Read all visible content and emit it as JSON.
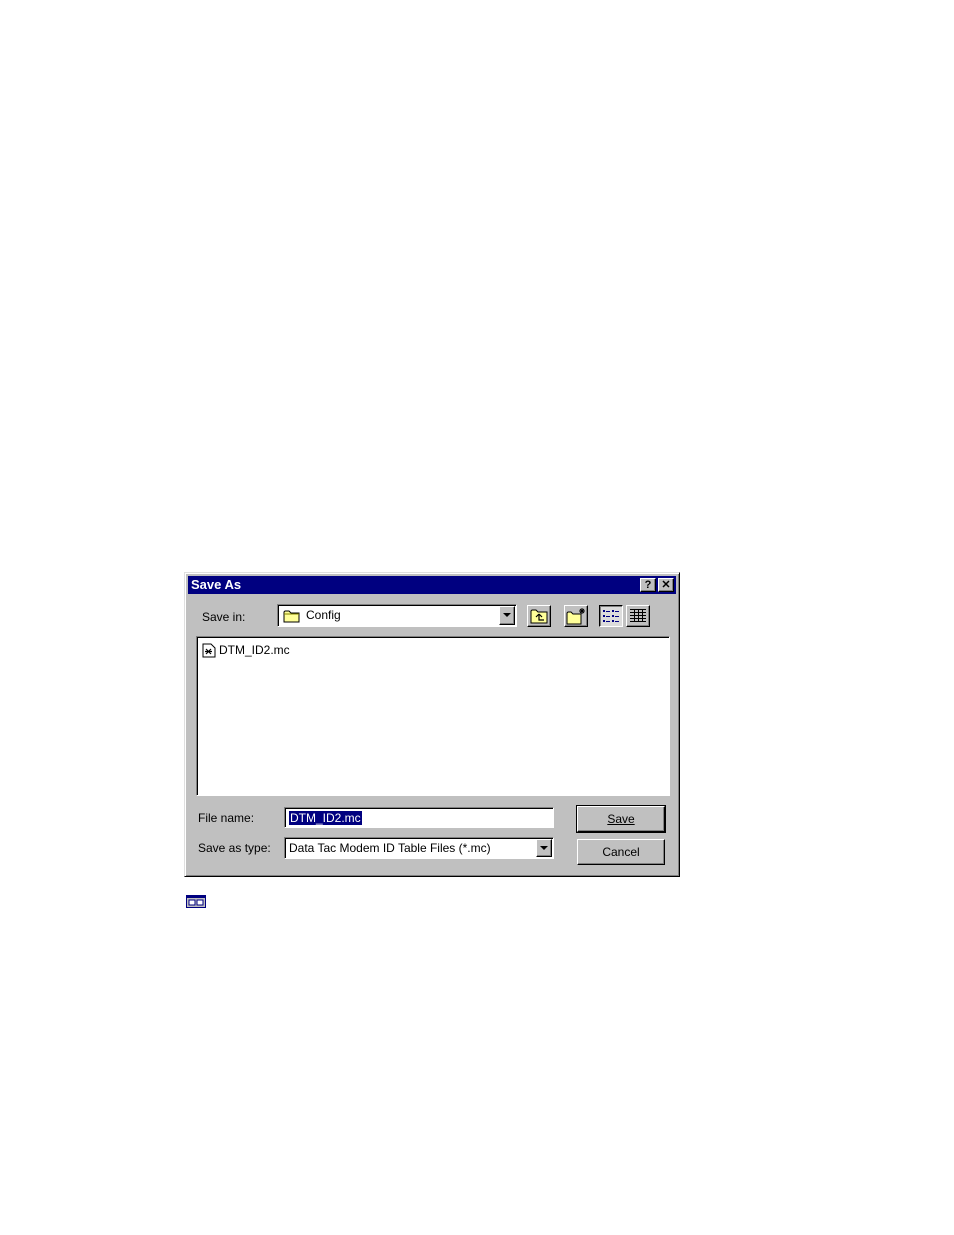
{
  "dialog": {
    "title": "Save As",
    "help_glyph": "?",
    "close_glyph": "✕",
    "save_in_label": "Save in:",
    "save_in_value": "Config",
    "toolbar": {
      "up_icon": "up-one-level-icon",
      "new_folder_icon": "new-folder-icon",
      "list_icon": "list-view-icon",
      "details_icon": "details-view-icon"
    },
    "files": [
      {
        "name": "DTM_ID2.mc",
        "icon": "file-icon"
      }
    ],
    "file_name_label": "File name:",
    "file_name_value": "DTM_ID2.mc",
    "save_type_label": "Save as type:",
    "save_type_value": "Data Tac Modem ID Table Files (*.mc)",
    "save_button": "Save",
    "cancel_button": "Cancel"
  },
  "colors": {
    "titlebar": "#000080",
    "face": "#c0c0c0",
    "selection": "#000080"
  }
}
